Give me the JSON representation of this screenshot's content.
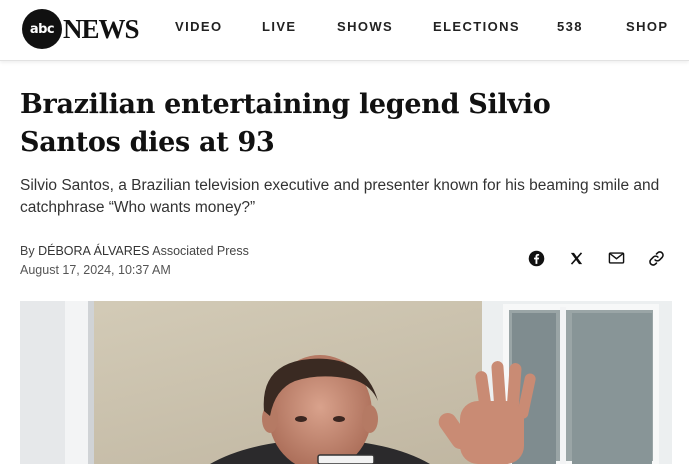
{
  "brand": {
    "logo_disc": "abc",
    "logo_word": "NEWS"
  },
  "nav": {
    "items": [
      {
        "label": "VIDEO"
      },
      {
        "label": "LIVE"
      },
      {
        "label": "SHOWS"
      },
      {
        "label": "ELECTIONS"
      },
      {
        "label": "538"
      },
      {
        "label": "SHOP"
      }
    ]
  },
  "article": {
    "headline": "Brazilian entertaining legend Silvio Santos dies at 93",
    "dek": "Silvio Santos, a Brazilian television executive and presenter known for his beaming smile and catchphrase “Who wants money?”",
    "byline_prefix": "By",
    "author": "DÉBORA ÁLVARES",
    "organization": "Associated Press",
    "date": "August 17, 2024, 10:37 AM"
  },
  "share": {
    "icons": [
      "facebook-icon",
      "x-icon",
      "email-icon",
      "link-icon"
    ]
  },
  "colors": {
    "text": "#111111",
    "header_border": "#e2e2e2"
  }
}
